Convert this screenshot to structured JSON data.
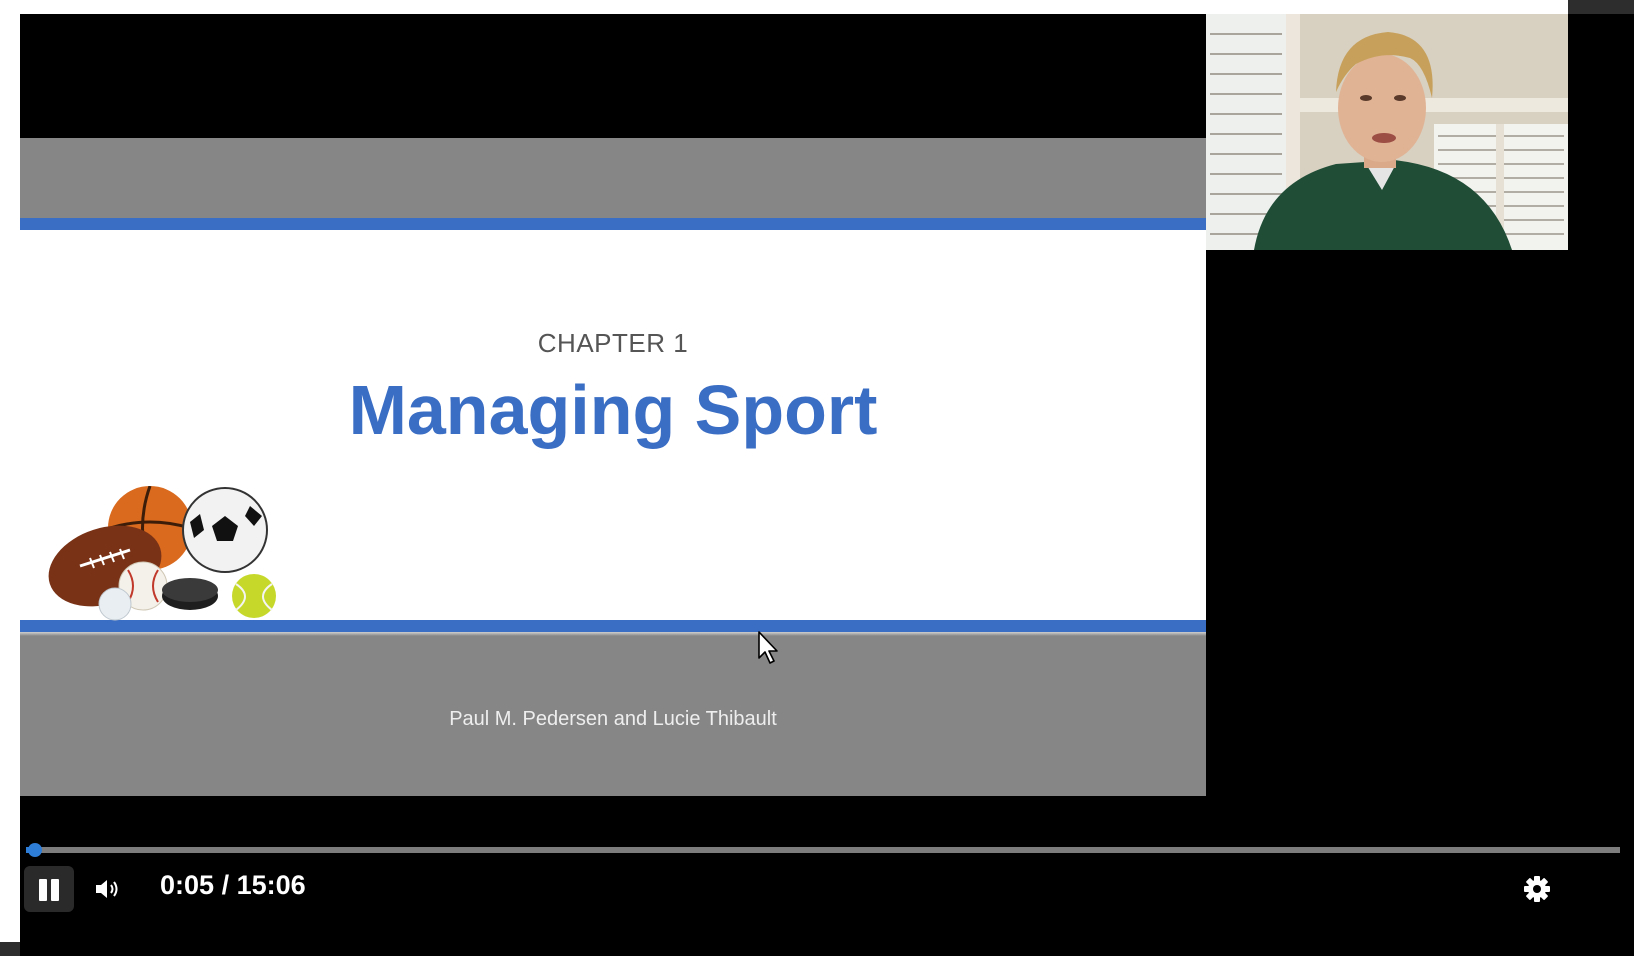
{
  "slide": {
    "chapter": "CHAPTER 1",
    "title": "Managing Sport",
    "authors": "Paul M. Pedersen and Lucie Thibault"
  },
  "controls": {
    "current_time": "0:05",
    "duration": "15:06",
    "separator": "/",
    "progress": 0.0055,
    "state": "playing"
  },
  "icons": {
    "pause": "pause-icon",
    "volume": "volume-icon",
    "settings": "gear-icon",
    "cursor": "mouse-cursor-icon"
  },
  "colors": {
    "accent": "#3a6dc4",
    "progress": "#2e7dd7"
  }
}
